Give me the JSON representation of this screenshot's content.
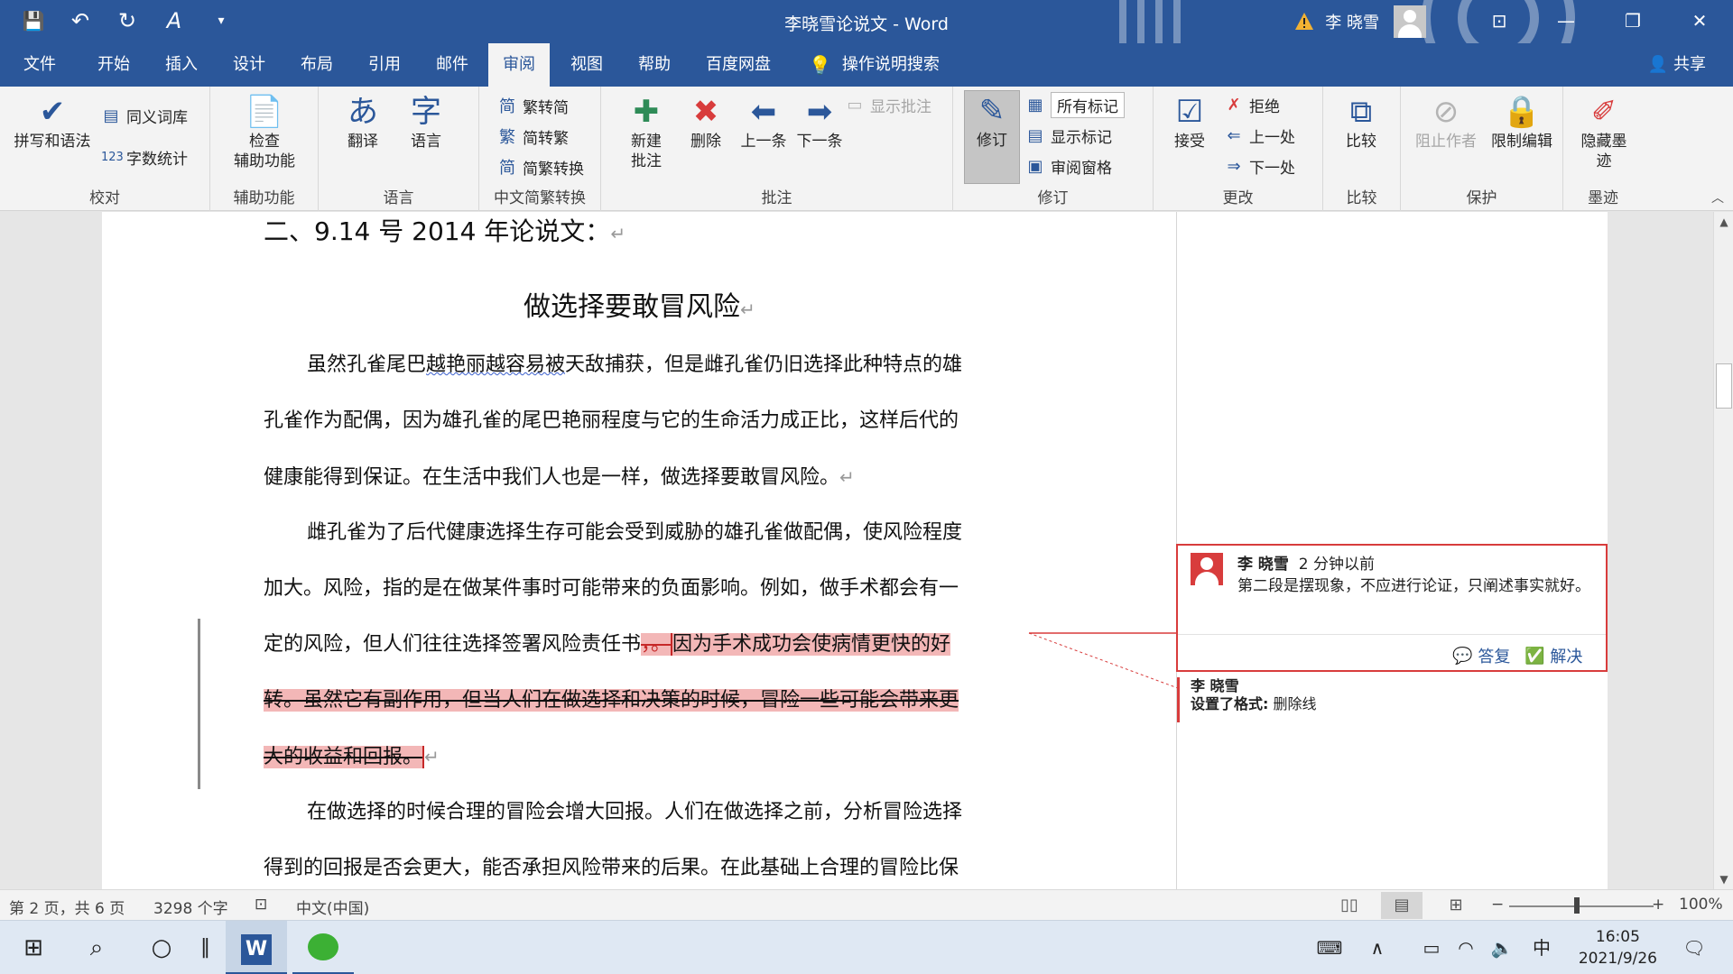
{
  "window": {
    "title": "李晓雪论说文 - Word",
    "user": "李 晓雪",
    "controls": {
      "restore_ribbon": "⊡",
      "minimize": "—",
      "maximize": "❐",
      "close": "✕"
    }
  },
  "quick_access": {
    "save": "💾",
    "undo": "↶",
    "redo": "↻",
    "format": "A",
    "customize": "▾"
  },
  "menu": {
    "tabs": [
      "文件",
      "开始",
      "插入",
      "设计",
      "布局",
      "引用",
      "邮件",
      "审阅",
      "视图",
      "帮助",
      "百度网盘"
    ],
    "active_tab": "审阅",
    "tell_me": "操作说明搜索",
    "share": "共享"
  },
  "ribbon": {
    "proofing": {
      "label": "校对",
      "spelling": "拼写和语法",
      "thesaurus": "同义词库",
      "word_count": "字数统计"
    },
    "accessibility": {
      "label": "辅助功能",
      "check_line1": "检查",
      "check_line2": "辅助功能"
    },
    "language": {
      "label": "语言",
      "translate": "翻译",
      "language": "语言"
    },
    "chinese": {
      "label": "中文简繁转换",
      "to_traditional": "繁转简",
      "to_simplified": "简转繁",
      "convert": "简繁转换"
    },
    "comments": {
      "label": "批注",
      "new_line1": "新建",
      "new_line2": "批注",
      "delete": "删除",
      "prev": "上一条",
      "next": "下一条",
      "show": "显示批注"
    },
    "tracking": {
      "label": "修订",
      "track": "修订",
      "display": "所有标记",
      "show_markup": "显示标记",
      "pane": "审阅窗格"
    },
    "changes": {
      "label": "更改",
      "accept": "接受",
      "reject": "拒绝",
      "prev": "上一处",
      "next": "下一处"
    },
    "compare": {
      "label": "比较",
      "compare": "比较"
    },
    "protect": {
      "label": "保护",
      "block": "阻止作者",
      "restrict": "限制编辑"
    },
    "ink": {
      "label": "墨迹",
      "hide_line1": "隐藏墨",
      "hide_line2": "迹"
    }
  },
  "document": {
    "heading": "二、9.14 号 2014 年论说文：",
    "title": "做选择要敢冒风险",
    "lines": {
      "p1_l1_a": "虽然孔雀尾巴",
      "p1_l1_b": "越艳丽越容易被",
      "p1_l1_c": "天敌捕获，但是雌孔雀仍旧选择此种特点的雄",
      "p1_l2": "孔雀作为配偶，因为雄孔雀的尾巴艳丽程度与它的生命活力成正比，这样后代的",
      "p1_l3": "健康能得到保证。在生活中我们人也是一样，做选择要敢冒风险。",
      "p2_l1": "雌孔雀为了后代健康选择生存可能会受到威胁的雄孔雀做配偶，使风险程度",
      "p2_l2": "加大。风险，指的是在做某件事时可能带来的负面影响。例如，做手术都会有一",
      "p2_l3_a": "定的风险，但人们往往选择签署风险责任书",
      "p2_l3_b": "，。",
      "p2_l3_c": "因为手术成功会使病情更快的好",
      "p2_l4": "转。虽然它有副作用，但当人们在做选择和决策的时候，冒险一些可能会带来更",
      "p2_l5": "大的收益和回报。",
      "p3_l1": "在做选择的时候合理的冒险会增大回报。人们在做选择之前，分析冒险选择",
      "p3_l2": "得到的回报是否会更大，能否承担风险带来的后果。在此基础上合理的冒险比保"
    },
    "para_mark": "↵"
  },
  "comment": {
    "author": "李 晓雪",
    "time": "2 分钟以前",
    "text": "第二段是摆现象，不应进行论证，只阐述事实就好。",
    "reply": "答复",
    "resolve": "解决"
  },
  "format_change": {
    "author": "李 晓雪",
    "label": "设置了格式:",
    "value": "删除线"
  },
  "status": {
    "page": "第 2 页，共 6 页",
    "words": "3298 个字",
    "language": "中文(中国)",
    "zoom": "100%",
    "zoom_level": 1.0
  },
  "taskbar": {
    "time": "16:05",
    "date": "2021/9/26",
    "ime": "中"
  },
  "colors": {
    "brand": "#2b579a",
    "comment": "#d83c3c",
    "deletion_highlight": "#f3b7b7"
  }
}
